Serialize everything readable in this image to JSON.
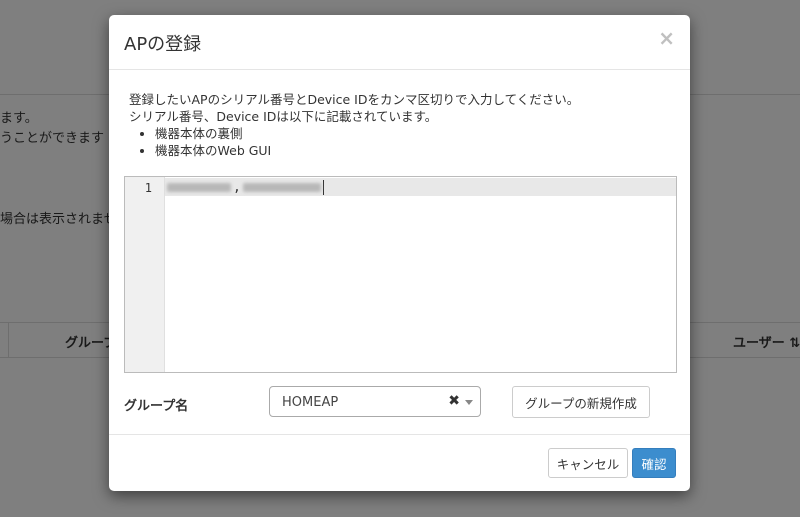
{
  "background": {
    "line1": "ます。",
    "line2": "うことができます",
    "line3": "場合は表示されませ",
    "table_headers": [
      "グループ",
      "ユーザー"
    ],
    "sort_icon": "sort-icon"
  },
  "modal": {
    "title": "APの登録",
    "close_label": "×",
    "instructions": {
      "line1": "登録したいAPのシリアル番号とDevice IDをカンマ区切りで入力してください。",
      "line2": "シリアル番号、Device IDは以下に記載されています。",
      "bullets": [
        "機器本体の裏側",
        "機器本体のWeb GUI"
      ]
    },
    "editor": {
      "line_number": "1",
      "separator": ","
    },
    "group_label": "グループ名",
    "group_select": {
      "value": "HOMEAP",
      "clear": "✖"
    },
    "new_group_button": "グループの新規作成",
    "cancel_button": "キャンセル",
    "confirm_button": "確認"
  },
  "colors": {
    "primary": "#3c8dce",
    "backdrop": "rgba(0,0,0,0.5)"
  }
}
